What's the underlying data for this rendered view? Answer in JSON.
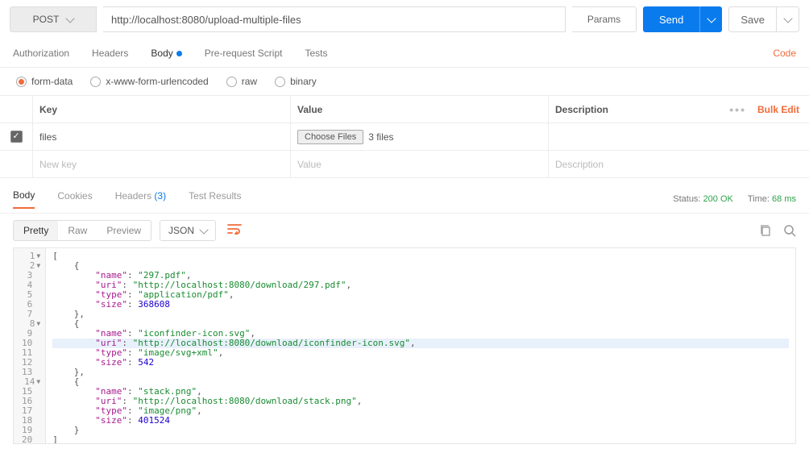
{
  "request": {
    "method": "POST",
    "url": "http://localhost:8080/upload-multiple-files",
    "paramsLabel": "Params",
    "sendLabel": "Send",
    "saveLabel": "Save"
  },
  "tabs": {
    "items": [
      "Authorization",
      "Headers",
      "Body",
      "Pre-request Script",
      "Tests"
    ],
    "activeIndex": 2,
    "codeLink": "Code"
  },
  "bodyTypes": {
    "items": [
      "form-data",
      "x-www-form-urlencoded",
      "raw",
      "binary"
    ],
    "selectedIndex": 0
  },
  "kvHeader": {
    "key": "Key",
    "value": "Value",
    "description": "Description"
  },
  "kvActions": {
    "bulkEdit": "Bulk Edit"
  },
  "kvRows": [
    {
      "key": "files",
      "fileBtn": "Choose Files",
      "fileText": "3 files",
      "checked": true
    }
  ],
  "kvNew": {
    "key": "New key",
    "value": "Value",
    "description": "Description"
  },
  "response": {
    "tabs": {
      "body": "Body",
      "cookies": "Cookies",
      "headers": "Headers",
      "headersCount": "(3)",
      "tests": "Test Results"
    },
    "statusLabel": "Status:",
    "statusValue": "200 OK",
    "timeLabel": "Time:",
    "timeValue": "68 ms"
  },
  "viewer": {
    "modes": [
      "Pretty",
      "Raw",
      "Preview"
    ],
    "activeMode": 0,
    "format": "JSON"
  },
  "lineNumbers": [
    "1",
    "2",
    "3",
    "4",
    "5",
    "6",
    "7",
    "8",
    "9",
    "10",
    "11",
    "12",
    "13",
    "14",
    "15",
    "16",
    "17",
    "18",
    "19",
    "20"
  ],
  "foldable": [
    0,
    1,
    7,
    13
  ],
  "code": {
    "obj1": {
      "name": "297.pdf",
      "uri": "http://localhost:8080/download/297.pdf",
      "type": "application/pdf",
      "size": "368608"
    },
    "obj2": {
      "name": "iconfinder-icon.svg",
      "uri": "http://localhost:8080/download/iconfinder-icon.svg",
      "type": "image/svg+xml",
      "size": "542"
    },
    "obj3": {
      "name": "stack.png",
      "uri": "http://localhost:8080/download/stack.png",
      "type": "image/png",
      "size": "401524"
    }
  }
}
